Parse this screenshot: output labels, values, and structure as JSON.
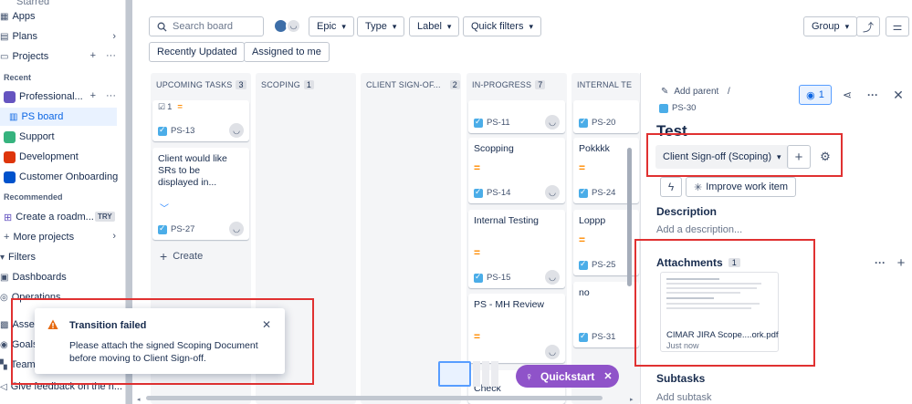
{
  "sidebar": {
    "items": [
      {
        "label": "Apps"
      },
      {
        "label": "Plans"
      },
      {
        "label": "Projects"
      },
      {
        "label": "Professional..."
      },
      {
        "label": "PS board"
      },
      {
        "label": "Support"
      },
      {
        "label": "Development"
      },
      {
        "label": "Customer Onboarding"
      },
      {
        "label": "Create a roadm..."
      },
      {
        "label": "More projects"
      },
      {
        "label": "Filters"
      },
      {
        "label": "Dashboards"
      },
      {
        "label": "Operations"
      },
      {
        "label": "Asset"
      },
      {
        "label": "Goals"
      },
      {
        "label": "Team"
      },
      {
        "label": "Give feedback on the n..."
      }
    ],
    "top_cut_label": "Starred",
    "recent_label": "Recent",
    "recommended_label": "Recommended",
    "try_badge": "TRY"
  },
  "toolbar": {
    "search_placeholder": "Search board",
    "epic": "Epic",
    "type": "Type",
    "label": "Label",
    "quick_filters": "Quick filters",
    "recently_updated": "Recently Updated",
    "assigned_to_me": "Assigned to me",
    "group": "Group"
  },
  "columns": [
    {
      "name": "UPCOMING TASKS",
      "count": "3"
    },
    {
      "name": "SCOPING",
      "count": "1"
    },
    {
      "name": "CLIENT SIGN-OF...",
      "count": "2"
    },
    {
      "name": "IN-PROGRESS",
      "count": "7"
    },
    {
      "name": "INTERNAL TE"
    }
  ],
  "cards": {
    "upcoming": [
      {
        "sub_count": "1",
        "key": "PS-13"
      },
      {
        "title": "Client would like SRs to be displayed in...",
        "key": "PS-27"
      }
    ],
    "create_label": "Create",
    "inprogress": [
      {
        "key": "PS-11"
      },
      {
        "title": "Scopping",
        "key": "PS-14"
      },
      {
        "title": "Internal Testing",
        "key": "PS-15"
      },
      {
        "title": "PS - MH Review"
      },
      {
        "title": "Check"
      }
    ],
    "internal": [
      {
        "key": "PS-20"
      },
      {
        "title": "Pokkkk",
        "key": "PS-24"
      },
      {
        "title": "Loppp",
        "key": "PS-25"
      },
      {
        "title": "no",
        "key": "PS-31"
      }
    ]
  },
  "panel": {
    "add_parent": "Add parent",
    "breadcrumb_sep": "/",
    "issue_key": "PS-30",
    "watch_count": "1",
    "title": "Test",
    "status": "Client Sign-off (Scoping)",
    "improve": "Improve work item",
    "description_heading": "Description",
    "description_placeholder": "Add a description...",
    "attachments_heading": "Attachments",
    "attachments_count": "1",
    "attachment_name": "CIMAR JIRA Scope....ork.pdf",
    "attachment_time": "Just now",
    "subtasks_heading": "Subtasks",
    "add_subtask": "Add subtask"
  },
  "toast": {
    "title": "Transition failed",
    "message": "Please attach the signed Scoping Document before moving to Client Sign-off."
  },
  "quickstart": {
    "label": "Quickstart"
  },
  "colors": {
    "accent": "#0c66e4",
    "highlight": "#e03131",
    "quickstart": "#8f53c9",
    "warning": "#e56910"
  }
}
